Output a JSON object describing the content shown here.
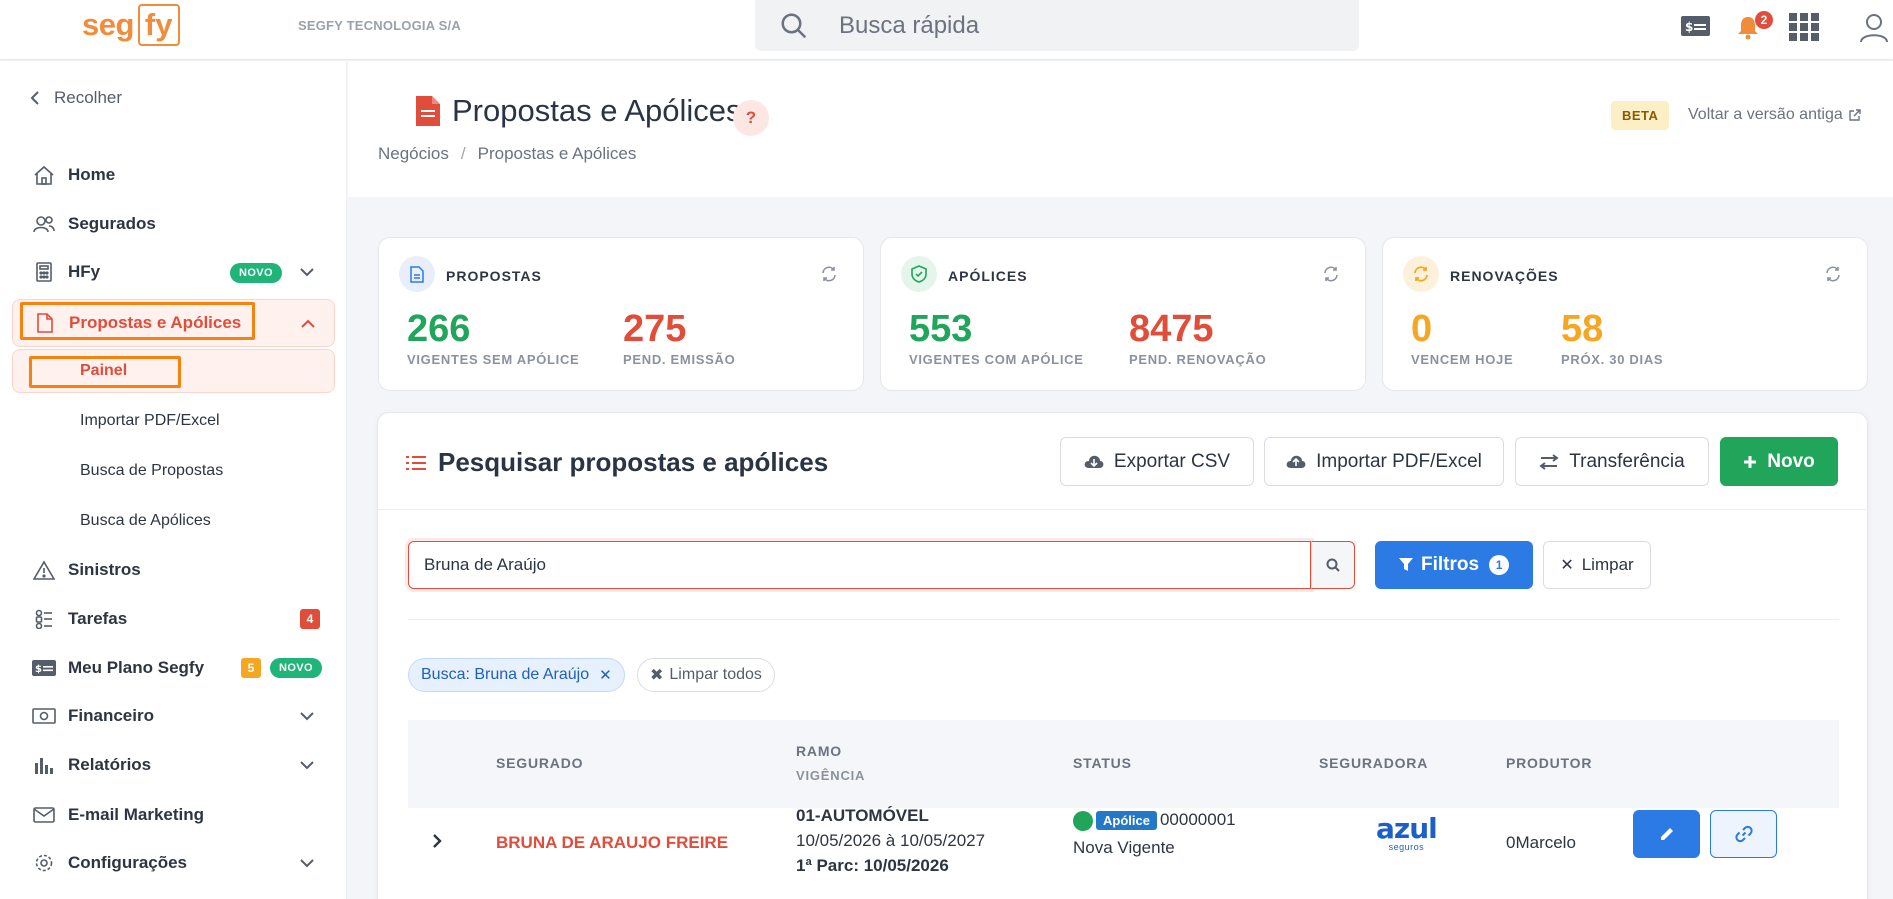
{
  "topbar": {
    "logo_left": "seg",
    "logo_right": "fy",
    "company": "SEGFY TECNOLOGIA S/A",
    "search_placeholder": "Busca rápida",
    "notification_count": "2"
  },
  "sidebar": {
    "collapse_label": "Recolher",
    "items": [
      {
        "label": "Home",
        "icon": "home-icon"
      },
      {
        "label": "Segurados",
        "icon": "users-icon"
      },
      {
        "label": "HFy",
        "icon": "calculator-icon",
        "badge": "NOVO"
      },
      {
        "label": "Propostas e Apólices",
        "icon": "file-icon"
      },
      {
        "label": "Sinistros",
        "icon": "warning-icon"
      },
      {
        "label": "Tarefas",
        "icon": "tasks-icon",
        "count": "4"
      },
      {
        "label": "Meu Plano Segfy",
        "icon": "plan-icon",
        "count": "5",
        "badge": "NOVO"
      },
      {
        "label": "Financeiro",
        "icon": "money-icon"
      },
      {
        "label": "Relatórios",
        "icon": "chart-icon"
      },
      {
        "label": "E-mail Marketing",
        "icon": "mail-icon"
      },
      {
        "label": "Configurações",
        "icon": "gear-icon"
      }
    ],
    "subitems": [
      "Painel",
      "Importar PDF/Excel",
      "Busca de Propostas",
      "Busca de Apólices"
    ]
  },
  "header": {
    "title": "Propostas e Apólices",
    "help": "?",
    "breadcrumb": [
      "Negócios",
      "Propostas e Apólices"
    ],
    "beta": "BETA",
    "old_version": "Voltar a versão antiga"
  },
  "stats": [
    {
      "title": "PROPOSTAS",
      "v1": "266",
      "l1": "VIGENTES SEM APÓLICE",
      "v2": "275",
      "l2": "PEND. EMISSÃO"
    },
    {
      "title": "APÓLICES",
      "v1": "553",
      "l1": "VIGENTES COM APÓLICE",
      "v2": "8475",
      "l2": "PEND. RENOVAÇÃO"
    },
    {
      "title": "RENOVAÇÕES",
      "v1": "0",
      "l1": "VENCEM HOJE",
      "v2": "58",
      "l2": "PRÓX. 30 DIAS"
    }
  ],
  "search_panel": {
    "title": "Pesquisar propostas e apólices",
    "export": "Exportar CSV",
    "import": "Importar PDF/Excel",
    "transfer": "Transferência",
    "new": "Novo",
    "query": "Bruna de Araújo",
    "filters": "Filtros",
    "filter_count": "1",
    "clear": "Limpar",
    "chip_search": "Busca: Bruna de Araújo",
    "chip_clear_all": "Limpar todos"
  },
  "table": {
    "headers": {
      "segurado": "SEGURADO",
      "ramo": "RAMO",
      "vigencia": "VIGÊNCIA",
      "status": "STATUS",
      "seguradora": "SEGURADORA",
      "produtor": "PRODUTOR"
    },
    "rows": [
      {
        "segurado": "BRUNA DE ARAUJO FREIRE",
        "ramo": "01-AUTOMÓVEL",
        "vigencia": "10/05/2026 à 10/05/2027",
        "parcela": "1ª Parc: 10/05/2026",
        "status_badge": "Apólice",
        "status_number": "00000001",
        "status_text": "Nova Vigente",
        "seguradora_logo": "azul",
        "seguradora_sub": "seguros",
        "produtor": "0Marcelo"
      }
    ]
  },
  "colors": {
    "accent": "#e14d3b",
    "green": "#21a55a",
    "blue": "#2c7be5",
    "orange": "#f5a623",
    "highlight": "#f7830e"
  }
}
